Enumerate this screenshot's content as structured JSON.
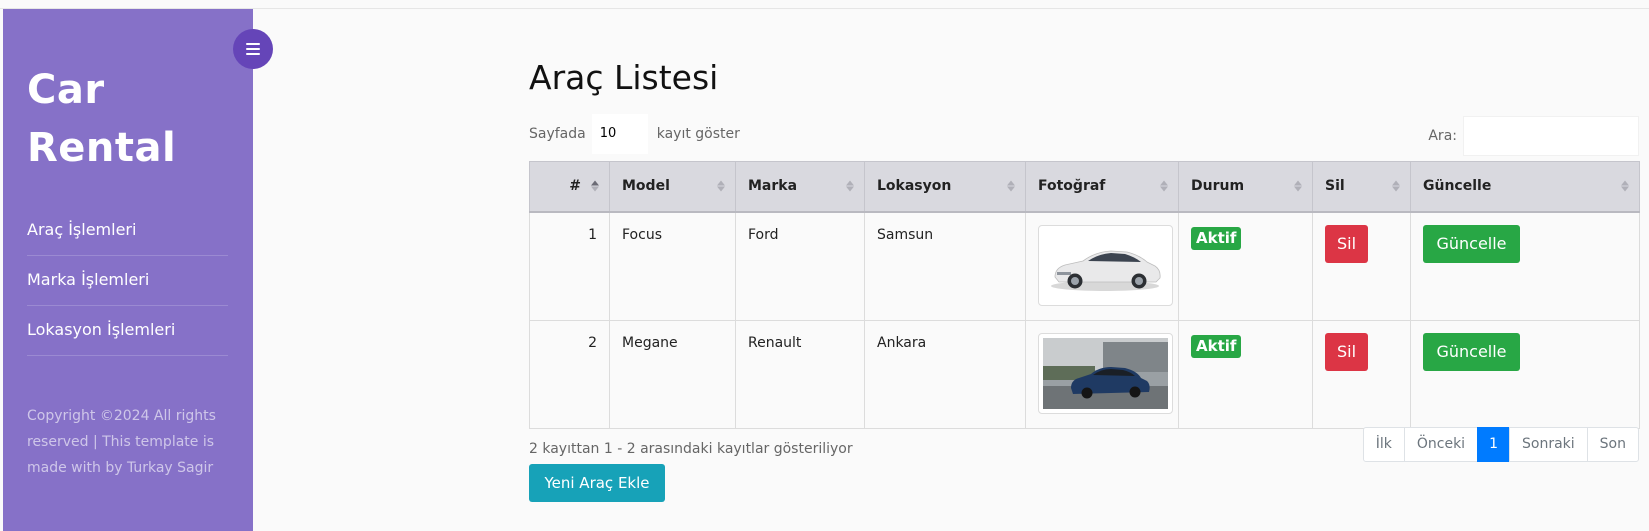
{
  "sidebar": {
    "brand_line1": "Car",
    "brand_line2": "Rental",
    "items": [
      {
        "label": "Araç İşlemleri"
      },
      {
        "label": "Marka İşlemleri"
      },
      {
        "label": "Lokasyon İşlemleri"
      }
    ],
    "copyright": "Copyright ©2024 All rights reserved | This template is made with by Turkay Sagir",
    "toggle_icon": "menu-icon"
  },
  "main": {
    "title": "Araç Listesi",
    "length": {
      "prefix": "Sayfada",
      "value": "10",
      "suffix": "kayıt göster"
    },
    "search": {
      "label": "Ara:",
      "value": ""
    },
    "columns": [
      "#",
      "Model",
      "Marka",
      "Lokasyon",
      "Fotoğraf",
      "Durum",
      "Sil",
      "Güncelle"
    ],
    "rows": [
      {
        "num": "1",
        "model": "Focus",
        "brand": "Ford",
        "location": "Samsun",
        "photo": "white-ford-focus",
        "status": "Aktif",
        "delete": "Sil",
        "update": "Güncelle"
      },
      {
        "num": "2",
        "model": "Megane",
        "brand": "Renault",
        "location": "Ankara",
        "photo": "blue-renault-megane",
        "status": "Aktif",
        "delete": "Sil",
        "update": "Güncelle"
      }
    ],
    "info": "2 kayıttan 1 - 2 arasındaki kayıtlar gösteriliyor",
    "add_button": "Yeni Araç Ekle",
    "pagination": {
      "first": "İlk",
      "prev": "Önceki",
      "current": "1",
      "next": "Sonraki",
      "last": "Son"
    }
  },
  "colors": {
    "sidebar": "#8671c8",
    "toggle": "#6545b8",
    "success": "#28a745",
    "danger": "#dc3545",
    "info": "#17a2b8",
    "primary": "#007bff"
  }
}
